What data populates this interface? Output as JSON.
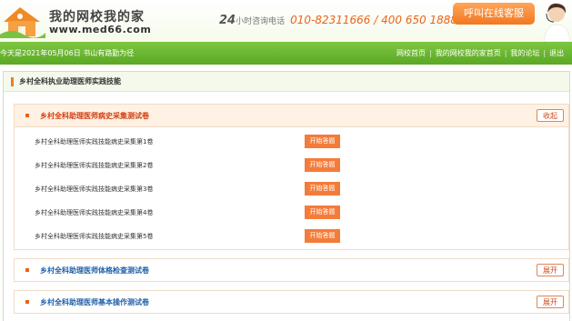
{
  "header": {
    "logo_title": "我的网校我的家",
    "logo_url": "www.med66.com",
    "hotline_prefix": "24",
    "hotline_label": "小时咨询电话",
    "hotline_numbers": "010-82311666 / 400 650 1888",
    "cs_button": "呼叫在线客服"
  },
  "navbar": {
    "date_text": "今天是2021年05月06日  书山有路勤为径",
    "links": [
      "网校首页",
      "我的网校我的家首页",
      "我的论坛",
      "退出"
    ]
  },
  "main": {
    "page_title": "乡村全科执业助理医师实践技能",
    "sections": [
      {
        "title": "乡村全科助理医师病史采集测试卷",
        "toggle_label": "收起",
        "expanded": true,
        "items": [
          {
            "name": "乡村全科助理医师实践技能病史采集第1卷",
            "action": "开始答题"
          },
          {
            "name": "乡村全科助理医师实践技能病史采集第2卷",
            "action": "开始答题"
          },
          {
            "name": "乡村全科助理医师实践技能病史采集第3卷",
            "action": "开始答题"
          },
          {
            "name": "乡村全科助理医师实践技能病史采集第4卷",
            "action": "开始答题"
          },
          {
            "name": "乡村全科助理医师实践技能病史采集第5卷",
            "action": "开始答题"
          }
        ]
      },
      {
        "title": "乡村全科助理医师体格检查测试卷",
        "toggle_label": "展开",
        "expanded": false
      },
      {
        "title": "乡村全科助理医师基本操作测试卷",
        "toggle_label": "展开",
        "expanded": false
      }
    ]
  },
  "colors": {
    "nav_green": "#6ab72f",
    "accent_orange": "#f47c3a",
    "open_title": "#d03c10",
    "closed_title": "#1e5fa8"
  }
}
